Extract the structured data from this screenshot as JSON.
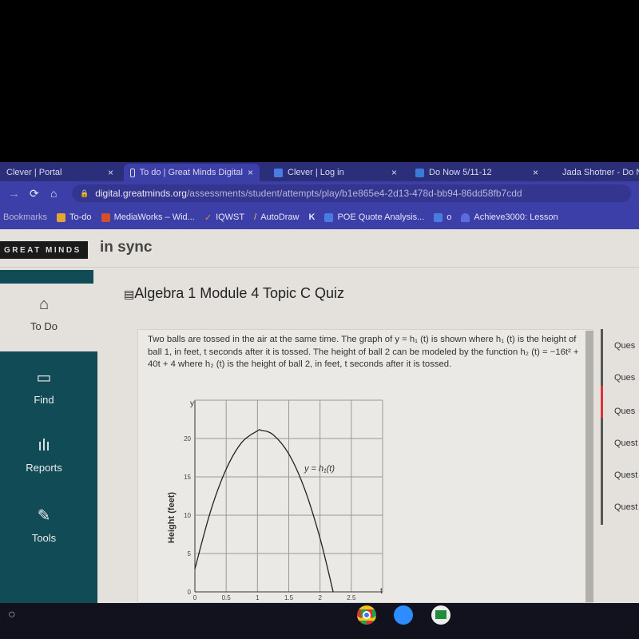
{
  "browser": {
    "tabs": [
      {
        "label": "Clever | Portal"
      },
      {
        "label": "To do | Great Minds Digital"
      },
      {
        "label": "Clever | Log in"
      },
      {
        "label": "Do Now 5/11-12"
      },
      {
        "label": "Jada Shotner - Do N"
      }
    ],
    "close_glyph": "×",
    "url_host": "digital.greatminds.org",
    "url_path": "/assessments/student/attempts/play/b1e865e4-2d13-478d-bb94-86dd58fb7cdd",
    "bookmarks_label": "Bookmarks",
    "bookmarks": [
      {
        "label": "To-do"
      },
      {
        "label": "MediaWorks – Wid..."
      },
      {
        "label": "IQWST"
      },
      {
        "label": "AutoDraw"
      },
      {
        "label": "K"
      },
      {
        "label": "POE Quote Analysis..."
      },
      {
        "label": "o"
      },
      {
        "label": "Achieve3000: Lesson"
      }
    ]
  },
  "app": {
    "logo": "GREAT MINDS",
    "product": "in sync",
    "nav": [
      {
        "label": "To Do",
        "icon": "home-icon"
      },
      {
        "label": "Find",
        "icon": "book-icon"
      },
      {
        "label": "Reports",
        "icon": "bar-chart-icon"
      },
      {
        "label": "Tools",
        "icon": "tools-icon"
      }
    ],
    "quiz_title": "Algebra 1 Module 4 Topic C Quiz",
    "question_text": "Two balls are tossed in the air at the same time. The graph of y = h₁ (t) is shown where h₁ (t) is the height of ball 1, in feet, t seconds after it is tossed. The height of ball 2 can be modeled by the function h₂ (t) = −16t² + 40t + 4 where h₂ (t) is the height of ball 2, in feet, t seconds after it is tossed.",
    "question_list": [
      "Ques",
      "Ques",
      "Ques",
      "Quest",
      "Quest",
      "Quest"
    ],
    "active_question_color": "#dd3333",
    "sidebar_color": "#114b56"
  },
  "chart_data": {
    "type": "line",
    "ylabel": "Height (feet)",
    "y_axis_label": "y",
    "x_axis_label": "t",
    "curve_label": "y = h₁(t)",
    "xticks": [
      "0",
      "0.5",
      "1",
      "1.5",
      "2",
      "2.5"
    ],
    "yticks": [
      "0",
      "5",
      "10",
      "15",
      "20"
    ],
    "xlim": [
      0,
      3
    ],
    "ylim": [
      0,
      25
    ],
    "grid": true,
    "x": [
      0,
      0.25,
      0.5,
      0.75,
      1,
      1.0625,
      1.25,
      1.5,
      1.75,
      2,
      2.21
    ],
    "y": [
      3,
      10.5,
      16,
      19.5,
      21,
      21.06,
      20.5,
      18,
      13.5,
      7,
      0
    ]
  },
  "taskbar": {
    "apps": [
      "chrome-icon",
      "zoom-icon",
      "classroom-icon"
    ]
  }
}
